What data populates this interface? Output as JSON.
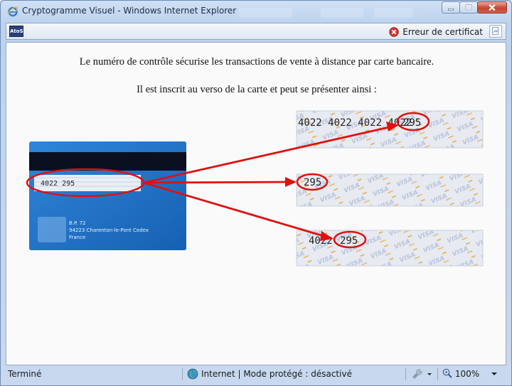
{
  "window": {
    "title": "Cryptogramme Visuel - Windows Internet Explorer"
  },
  "commandbar": {
    "logo_text": "AtoS",
    "cert_error_label": "Erreur de certificat"
  },
  "content": {
    "line1": "Le numéro de contrôle sécurise les transactions de vente à distance par carte bancaire.",
    "line2": "Il est inscrit au verso de la carte et peut se présenter ainsi :",
    "card": {
      "signature_number": "4022 295",
      "address_lines": [
        "B.P. 72",
        "94223 Charenton-le-Pont Cedex",
        "France"
      ]
    },
    "examples": [
      {
        "prefix": "4022 4022 4022 4022",
        "code": "295"
      },
      {
        "prefix": "",
        "code": "295"
      },
      {
        "prefix": "4022",
        "code": "295"
      }
    ]
  },
  "statusbar": {
    "status_text": "Terminé",
    "zone_text": "Internet | Mode protégé : désactivé",
    "zoom": "100%"
  },
  "colors": {
    "highlight_red": "#e01010",
    "card_blue": "#1f74c8",
    "titlebar_blue": "#c8d9ef"
  }
}
